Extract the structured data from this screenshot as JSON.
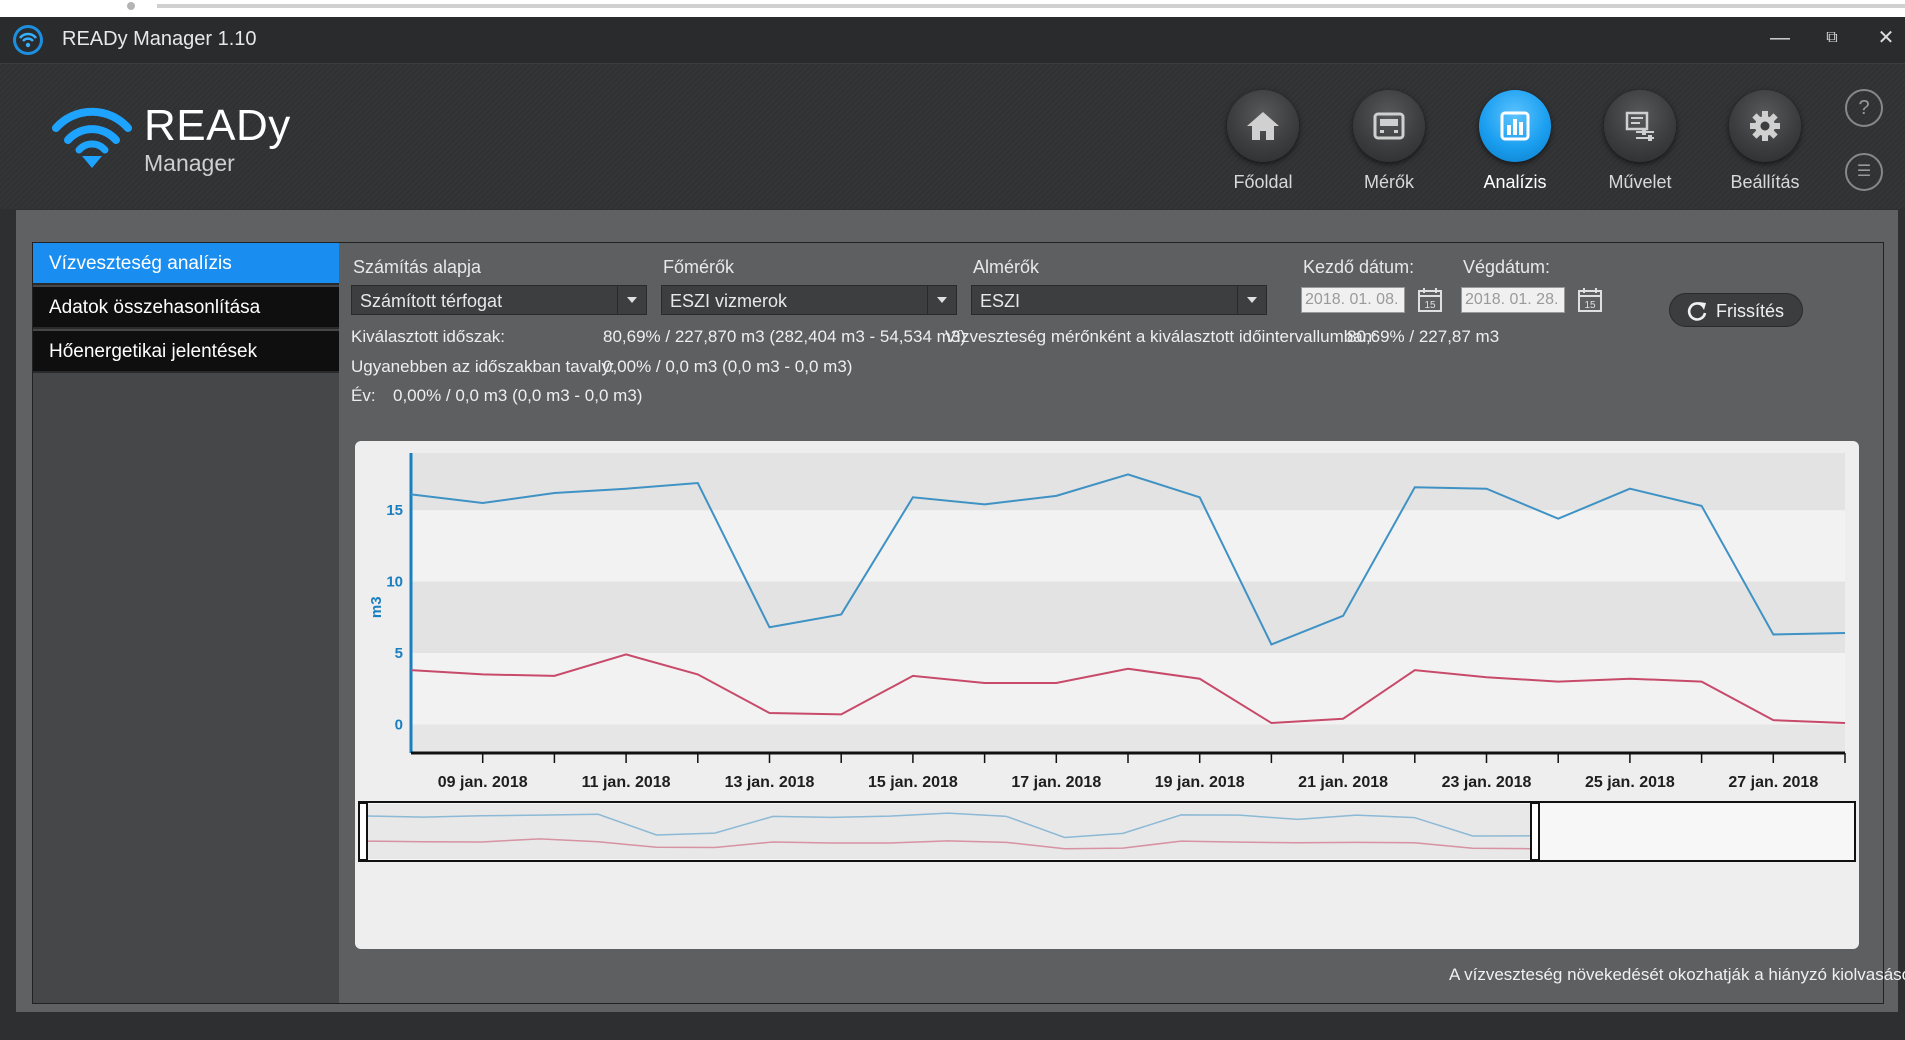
{
  "window": {
    "title": "READy Manager 1.10",
    "minimize": "—",
    "maximize": "⧉",
    "close": "✕"
  },
  "logo": {
    "brand": "READy",
    "sub": "Manager"
  },
  "nav": [
    {
      "label": "Főoldal",
      "icon": "home-icon",
      "active": false
    },
    {
      "label": "Mérők",
      "icon": "meter-icon",
      "active": false
    },
    {
      "label": "Analízis",
      "icon": "chart-icon",
      "active": true
    },
    {
      "label": "Művelet",
      "icon": "operation-icon",
      "active": false
    },
    {
      "label": "Beállítás",
      "icon": "gear-icon",
      "active": false
    }
  ],
  "side_icons": {
    "help": "?",
    "list": "☰"
  },
  "menu": [
    {
      "label": "Vízveszteség analízis",
      "active": true
    },
    {
      "label": "Adatok összehasonlítása",
      "active": false
    },
    {
      "label": "Hőenergetikai jelentések",
      "active": false
    }
  ],
  "filters": {
    "calc_label": "Számítás alapja",
    "calc_value": "Számított térfogat",
    "main_label": "Főmérők",
    "main_value": "ESZI vizmerok",
    "sub_label": "Almérők",
    "sub_value": "ESZI",
    "start_label": "Kezdő dátum:",
    "start_value": "2018. 01. 08.",
    "end_label": "Végdátum:",
    "end_value": "2018. 01. 28.",
    "calendar_glyph": "15",
    "refresh_label": "Frissítés"
  },
  "info": {
    "selected_label": "Kiválasztott időszak:",
    "selected_value": "80,69% / 227,870 m3 (282,404 m3 - 54,534 m3)",
    "per_meter_label": "Vízveszteség mérőnként a kiválasztott időintervallumban:",
    "per_meter_value": "80,69% / 227,87 m3",
    "lastyear_label": "Ugyanebben az időszakban tavaly:",
    "lastyear_value": "0,00% / 0,0 m3 (0,0 m3 - 0,0 m3)",
    "year_label": "Év:",
    "year_value": "0,00% / 0,0 m3 (0,0 m3 - 0,0 m3)"
  },
  "footnote": "A vízveszteség növekedését okozhatják a hiányzó kiolvasások",
  "chart_data": {
    "type": "line",
    "ylabel": "m3",
    "ylim": [
      -2,
      19
    ],
    "yticks": [
      0,
      5,
      10,
      15
    ],
    "xlim": [
      8,
      28
    ],
    "x": [
      8,
      9,
      10,
      11,
      12,
      13,
      14,
      15,
      16,
      17,
      18,
      19,
      20,
      21,
      22,
      23,
      24,
      25,
      26,
      27,
      28
    ],
    "xticks": [
      {
        "x": 9,
        "label": "09 jan. 2018"
      },
      {
        "x": 11,
        "label": "11 jan. 2018"
      },
      {
        "x": 13,
        "label": "13 jan. 2018"
      },
      {
        "x": 15,
        "label": "15 jan. 2018"
      },
      {
        "x": 17,
        "label": "17 jan. 2018"
      },
      {
        "x": 19,
        "label": "19 jan. 2018"
      },
      {
        "x": 21,
        "label": "21 jan. 2018"
      },
      {
        "x": 23,
        "label": "23 jan. 2018"
      },
      {
        "x": 25,
        "label": "25 jan. 2018"
      },
      {
        "x": 27,
        "label": "27 jan. 2018"
      }
    ],
    "series": [
      {
        "color": "#3f92c4",
        "values": [
          16.1,
          15.5,
          16.2,
          16.5,
          16.9,
          6.8,
          7.7,
          15.9,
          15.4,
          16.0,
          17.5,
          15.9,
          5.6,
          7.6,
          16.6,
          16.5,
          14.4,
          16.5,
          15.3,
          6.3,
          6.4
        ]
      },
      {
        "color": "#c84a6a",
        "values": [
          3.8,
          3.5,
          3.4,
          4.9,
          3.5,
          0.8,
          0.7,
          3.4,
          2.9,
          2.9,
          3.9,
          3.2,
          0.1,
          0.4,
          3.8,
          3.3,
          3.0,
          3.2,
          3.0,
          0.3,
          0.1
        ]
      }
    ],
    "grid": "alternating horizontal bands",
    "navigator": true
  }
}
